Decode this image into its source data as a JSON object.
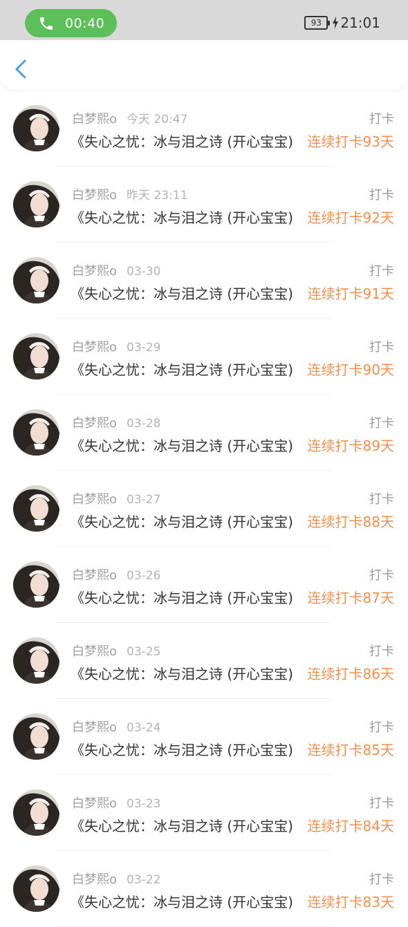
{
  "status_bar": {
    "call_duration": "00:40",
    "battery_level": "93",
    "clock": "21:01",
    "call_color": "#5cbf5a"
  },
  "nav": {
    "back_icon": "chevron-left-icon",
    "accent_color": "#4a9ee0"
  },
  "entries": [
    {
      "name": "白梦熙o",
      "time": "今天 20:47",
      "tag": "打卡",
      "title": "《失心之忧：冰与泪之诗 (开心宝宝)",
      "streak": "连续打卡93天"
    },
    {
      "name": "白梦熙o",
      "time": "昨天 23:11",
      "tag": "打卡",
      "title": "《失心之忧：冰与泪之诗 (开心宝宝)",
      "streak": "连续打卡92天"
    },
    {
      "name": "白梦熙o",
      "time": "03-30",
      "tag": "打卡",
      "title": "《失心之忧：冰与泪之诗 (开心宝宝)",
      "streak": "连续打卡91天"
    },
    {
      "name": "白梦熙o",
      "time": "03-29",
      "tag": "打卡",
      "title": "《失心之忧：冰与泪之诗 (开心宝宝)",
      "streak": "连续打卡90天"
    },
    {
      "name": "白梦熙o",
      "time": "03-28",
      "tag": "打卡",
      "title": "《失心之忧：冰与泪之诗 (开心宝宝)",
      "streak": "连续打卡89天"
    },
    {
      "name": "白梦熙o",
      "time": "03-27",
      "tag": "打卡",
      "title": "《失心之忧：冰与泪之诗 (开心宝宝)",
      "streak": "连续打卡88天"
    },
    {
      "name": "白梦熙o",
      "time": "03-26",
      "tag": "打卡",
      "title": "《失心之忧：冰与泪之诗 (开心宝宝)",
      "streak": "连续打卡87天"
    },
    {
      "name": "白梦熙o",
      "time": "03-25",
      "tag": "打卡",
      "title": "《失心之忧：冰与泪之诗 (开心宝宝)",
      "streak": "连续打卡86天"
    },
    {
      "name": "白梦熙o",
      "time": "03-24",
      "tag": "打卡",
      "title": "《失心之忧：冰与泪之诗 (开心宝宝)",
      "streak": "连续打卡85天"
    },
    {
      "name": "白梦熙o",
      "time": "03-23",
      "tag": "打卡",
      "title": "《失心之忧：冰与泪之诗 (开心宝宝)",
      "streak": "连续打卡84天"
    },
    {
      "name": "白梦熙o",
      "time": "03-22",
      "tag": "打卡",
      "title": "《失心之忧：冰与泪之诗 (开心宝宝)",
      "streak": "连续打卡83天"
    }
  ],
  "colors": {
    "streak": "#f0904f",
    "meta": "#9a9a9a",
    "title": "#333333"
  }
}
